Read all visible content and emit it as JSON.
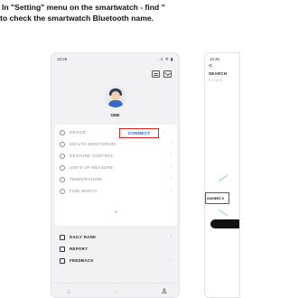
{
  "instructions": {
    "line1": "In \"Setting\" menu on the smartwatch - find \"",
    "line2": "to check the smartwatch Bluetooth name."
  },
  "phone1": {
    "time": "10:26",
    "signal": "..ıl ᯤ ▮",
    "user_name": "ONE",
    "menu": [
      {
        "label": "DEVICE",
        "icon": "device-icon"
      },
      {
        "label": "HEALTH MONITORING",
        "icon": "heart-icon"
      },
      {
        "label": "GESTURE CONTROL",
        "icon": "gesture-icon"
      },
      {
        "label": "UNITS OF MEASURE",
        "icon": "ruler-icon"
      },
      {
        "label": "TEMPERATURE",
        "icon": "thermometer-icon"
      },
      {
        "label": "FIND WATCH",
        "icon": "find-icon"
      }
    ],
    "connect_label": "CONNECT",
    "more_chevron": "»",
    "list2": [
      {
        "label": "DAILY RANK",
        "icon": "chart-icon"
      },
      {
        "label": "REPORT",
        "icon": "report-icon"
      },
      {
        "label": "FEEDBACK",
        "icon": "feedback-icon"
      }
    ],
    "tabs": [
      "home-icon",
      "activity-icon",
      "profile-icon"
    ],
    "accent_color": "#1a56db",
    "highlight_color": "#e02424"
  },
  "phone2": {
    "time": "10:26",
    "back": "<",
    "title": "SEARCH",
    "subtitle": "PLEASE",
    "device_name": "ADINEBT-0"
  }
}
